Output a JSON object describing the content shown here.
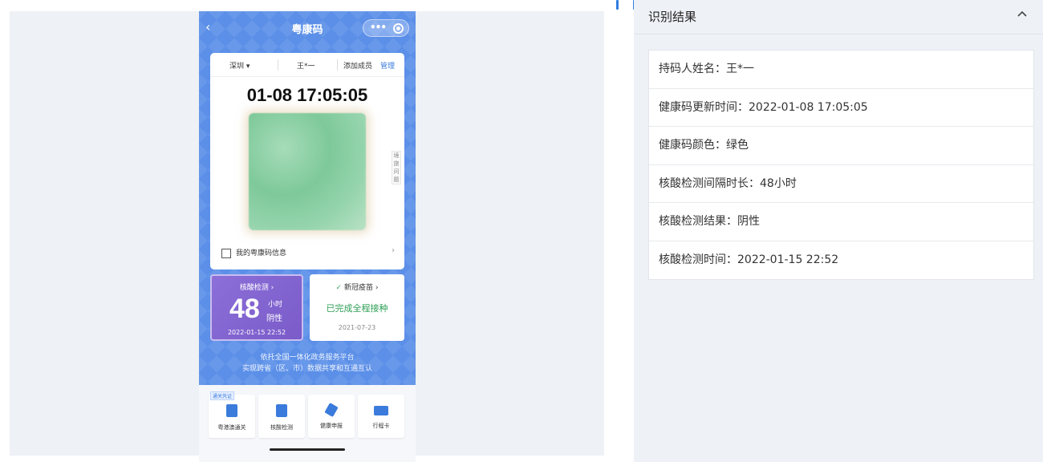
{
  "phone": {
    "nav": {
      "back_icon": "chevron-left-icon",
      "title": "粤康码",
      "more_icon": "ellipsis-icon",
      "close_icon": "target-icon"
    },
    "card": {
      "city": "深圳 ▾",
      "name": "王*一",
      "add_member": "添加成员",
      "manage": "管理",
      "datetime": "01-08  17:05:05",
      "side_label": "境 旅 问 题",
      "my_info": "我的粤康码信息",
      "chevron": "›"
    },
    "nat": {
      "label": "核酸检测 ›",
      "hours": "48",
      "unit": "小时",
      "result": "阴性",
      "date": "2022-01-15 22:52"
    },
    "vaccine": {
      "label": "新冠疫苗 ›",
      "status": "已完成全程接种",
      "date": "2021-07-23"
    },
    "slogan": [
      "依托全国一体化政务服务平台",
      "实现跨省（区、市）数据共享和互通互认"
    ],
    "bottom": [
      {
        "label": "粤港澳通关",
        "icon": "passport-icon",
        "tag": "通关凭证"
      },
      {
        "label": "核酸检测",
        "icon": "test-tube-icon"
      },
      {
        "label": "健康申报",
        "icon": "pen-icon"
      },
      {
        "label": "行程卡",
        "icon": "card-icon"
      }
    ]
  },
  "result": {
    "title": "识别结果",
    "collapse_icon": "chevron-up-icon",
    "rows": [
      "持码人姓名：王*一",
      "健康码更新时间：2022-01-08 17:05:05",
      "健康码颜色：绿色",
      "核酸检测间隔时长：48小时",
      "核酸检测结果：阴性",
      "核酸检测时间：2022-01-15 22:52"
    ]
  }
}
